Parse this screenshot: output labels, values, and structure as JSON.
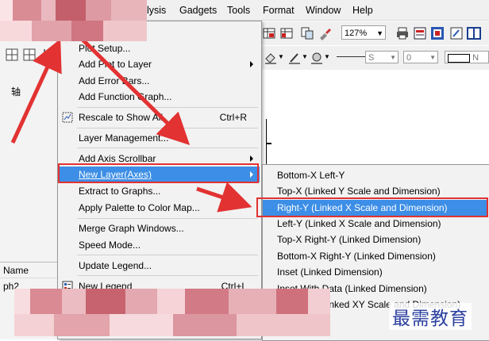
{
  "menubar": {
    "items": [
      {
        "label": "alysis"
      },
      {
        "label": "Gadgets"
      },
      {
        "label": "Tools"
      },
      {
        "label": "Format"
      },
      {
        "label": "Window"
      },
      {
        "label": "Help"
      }
    ]
  },
  "toolbar": {
    "zoom": "127%",
    "font_size_box": "S",
    "line_width_box": "0",
    "style_box": "N"
  },
  "left_panel": {
    "label_top": "轴",
    "label_name": "Name",
    "label_graph": "ph2"
  },
  "context_menu": {
    "items": [
      {
        "label": "Plot Setup...",
        "shortcut": ""
      },
      {
        "label": "Add Plot to Layer",
        "shortcut": ""
      },
      {
        "label": "Add Error Bars...",
        "shortcut": ""
      },
      {
        "label": "Add Function Graph...",
        "shortcut": ""
      },
      {
        "label": "Rescale to Show All",
        "shortcut": "Ctrl+R"
      },
      {
        "label": "Layer Management...",
        "shortcut": ""
      },
      {
        "label": "Add Axis Scrollbar",
        "shortcut": ""
      },
      {
        "label": "New Layer(Axes)",
        "shortcut": ""
      },
      {
        "label": "Extract to Graphs...",
        "shortcut": ""
      },
      {
        "label": "Apply Palette to Color Map...",
        "shortcut": ""
      },
      {
        "label": "Merge Graph Windows...",
        "shortcut": ""
      },
      {
        "label": "Speed Mode...",
        "shortcut": ""
      },
      {
        "label": "Update Legend...",
        "shortcut": ""
      },
      {
        "label": "New Legend",
        "shortcut": "Ctrl+L"
      }
    ]
  },
  "submenu": {
    "items": [
      {
        "label": "Bottom-X Left-Y"
      },
      {
        "label": "Top-X (Linked Y Scale and Dimension)"
      },
      {
        "label": "Right-Y (Linked X Scale and Dimension)"
      },
      {
        "label": "Left-Y (Linked X Scale and Dimension)"
      },
      {
        "label": "Top-X Right-Y (Linked Dimension)"
      },
      {
        "label": "Bottom-X Right-Y (Linked Dimension)"
      },
      {
        "label": "Inset (Linked Dimension)"
      },
      {
        "label": "Inset With Data (Linked Dimension)"
      },
      {
        "label": "(Linked XY Scale and Dimension)"
      }
    ]
  },
  "watermark": "最需教育",
  "colors": {
    "highlight": "#3c8ee6",
    "annotation_red": "#e23232"
  }
}
